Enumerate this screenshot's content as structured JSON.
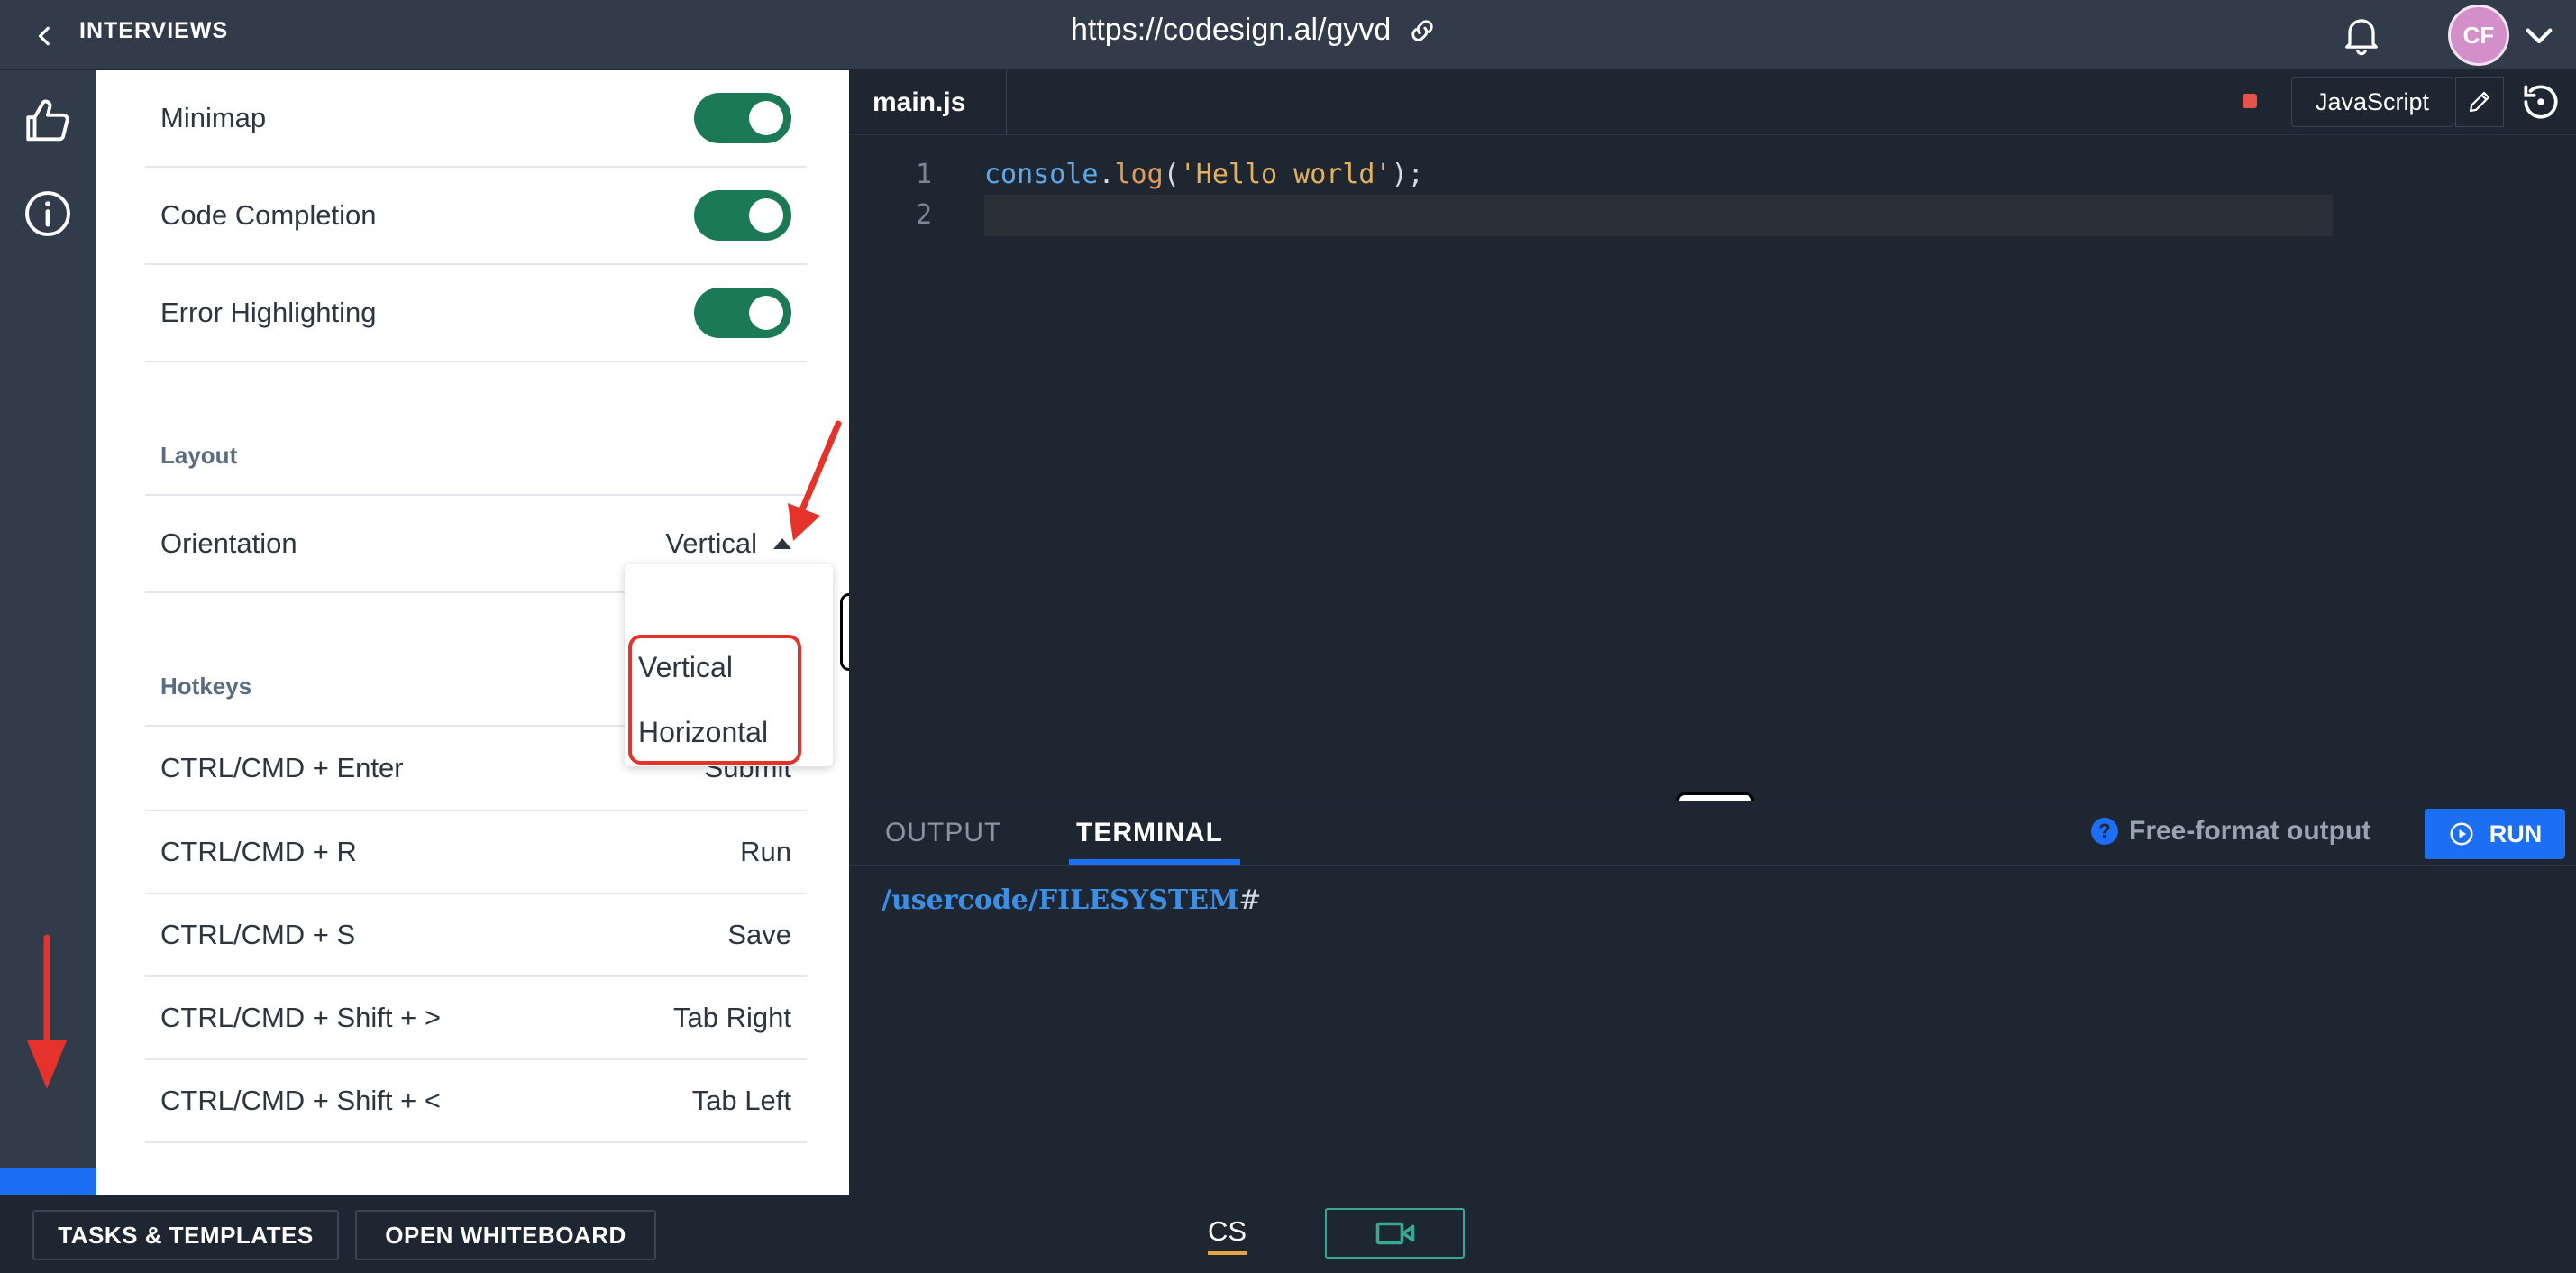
{
  "topbar": {
    "back_label": "INTERVIEWS",
    "url": "https://codesign.al/gyvd",
    "avatar_initials": "CF"
  },
  "settings": {
    "toggles": [
      {
        "label": "Minimap",
        "on": true
      },
      {
        "label": "Code Completion",
        "on": true
      },
      {
        "label": "Error Highlighting",
        "on": true
      }
    ],
    "layout_heading": "Layout",
    "orientation_label": "Orientation",
    "orientation_value": "Vertical",
    "orientation_options": [
      "Vertical",
      "Horizontal"
    ],
    "hotkeys_heading": "Hotkeys",
    "hotkeys": [
      {
        "keys": "CTRL/CMD + Enter",
        "action": "Submit"
      },
      {
        "keys": "CTRL/CMD + R",
        "action": "Run"
      },
      {
        "keys": "CTRL/CMD + S",
        "action": "Save"
      },
      {
        "keys": "CTRL/CMD + Shift + >",
        "action": "Tab Right"
      },
      {
        "keys": "CTRL/CMD + Shift + <",
        "action": "Tab Left"
      }
    ]
  },
  "editor": {
    "file_tab": "main.js",
    "language": "JavaScript",
    "line_numbers": [
      "1",
      "2"
    ],
    "code_tokens": [
      "console",
      ".",
      "log",
      "(",
      "'Hello world'",
      ");"
    ]
  },
  "bottom_pane": {
    "tabs": [
      "OUTPUT",
      "TERMINAL"
    ],
    "active_tab": "TERMINAL",
    "free_format_label": "Free-format output",
    "help_glyph": "?",
    "run_label": "RUN",
    "prompt_path": "/usercode/FILESYSTEM",
    "prompt_hash": "#"
  },
  "footer": {
    "tasks_label": "TASKS & TEMPLATES",
    "whiteboard_label": "OPEN WHITEBOARD",
    "cs_label": "CS"
  },
  "colors": {
    "accent_blue": "#1c6ef2",
    "toggle_green": "#1b7a55",
    "annotation_red": "#e5322b"
  }
}
